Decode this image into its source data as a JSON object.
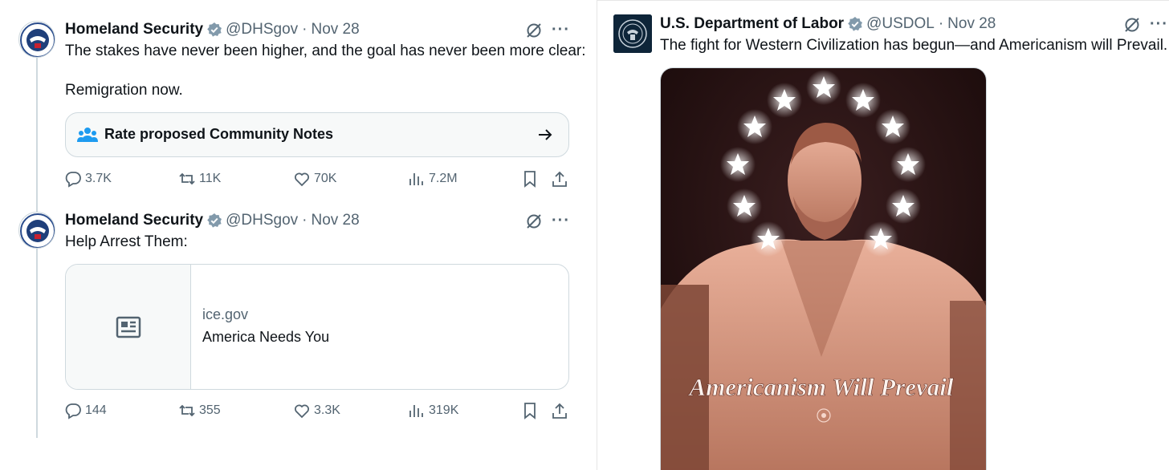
{
  "left_thread": {
    "tweet1": {
      "author_name": "Homeland Security",
      "handle": "@DHSgov",
      "separator": "·",
      "date": "Nov 28",
      "text_line1": "The stakes have never been higher, and the goal has never been more clear:",
      "text_line2": "Remigration now.",
      "community_notes_label": "Rate proposed Community Notes",
      "replies": "3.7K",
      "reposts": "11K",
      "likes": "70K",
      "views": "7.2M",
      "more_label": "···"
    },
    "tweet2": {
      "author_name": "Homeland Security",
      "handle": "@DHSgov",
      "separator": "·",
      "date": "Nov 28",
      "text": "Help Arrest Them:",
      "link_domain": "ice.gov",
      "link_title": "America Needs You",
      "replies": "144",
      "reposts": "355",
      "likes": "3.3K",
      "views": "319K",
      "more_label": "···"
    }
  },
  "right_tweet": {
    "author_name": "U.S. Department of Labor",
    "handle": "@USDOL",
    "separator": "·",
    "date": "Nov 28",
    "text": "The fight for Western Civilization has begun—and Americanism will Prevail.",
    "image_caption": "Americanism Will Prevail",
    "more_label": "···"
  },
  "colors": {
    "accent": "#1d9bf0",
    "muted": "#536471",
    "border": "#cfd9de",
    "image_tint": "#e7a48c"
  },
  "icons": [
    "verified-badge-icon",
    "grok-icon",
    "more-icon",
    "community-notes-icon",
    "arrow-right-icon",
    "reply-icon",
    "repost-icon",
    "like-icon",
    "views-icon",
    "bookmark-icon",
    "share-icon",
    "article-icon"
  ]
}
